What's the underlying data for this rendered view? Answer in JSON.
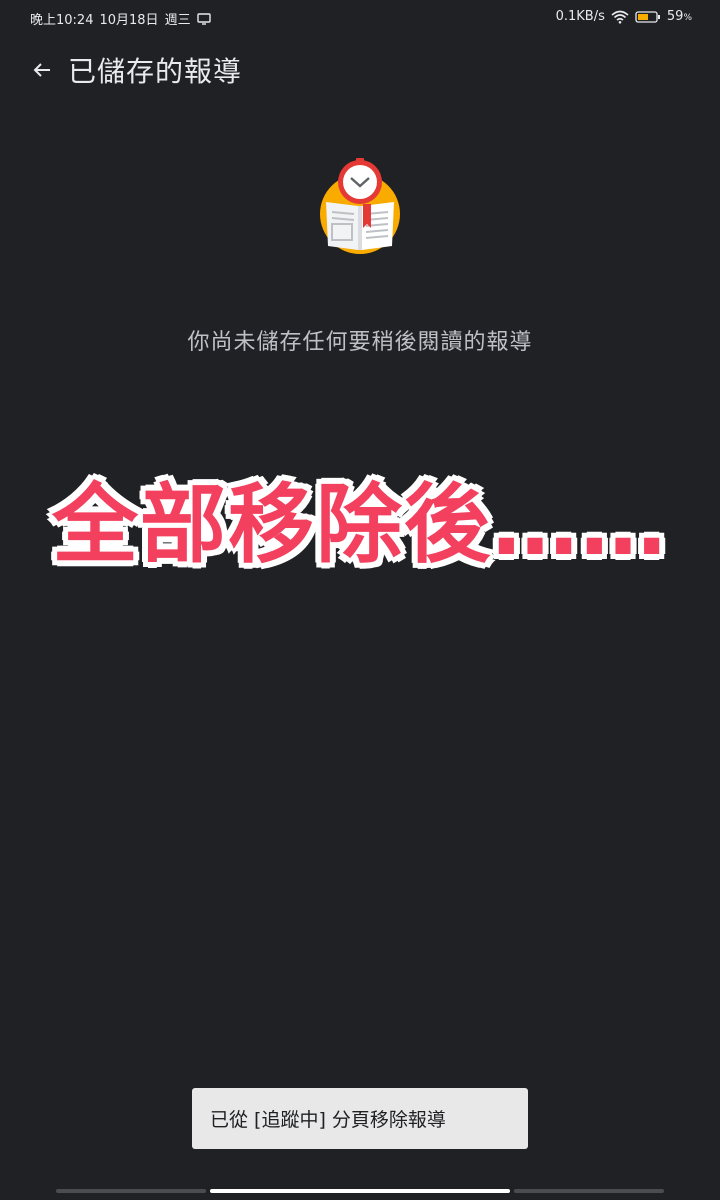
{
  "status_bar": {
    "time": "晚上10:24",
    "date": "10月18日",
    "weekday": "週三",
    "network_speed": "0.1KB/s",
    "battery_value": "59",
    "battery_unit": "%",
    "battery_level": 0.59
  },
  "app_bar": {
    "title": "已儲存的報導",
    "back_icon": "arrow-left-icon"
  },
  "empty_state": {
    "illustration_icon": "saved-news-clock-icon",
    "message": "你尚未儲存任何要稍後閱讀的報導"
  },
  "overlay": {
    "caption": "全部移除後……"
  },
  "snackbar": {
    "text": "已從 [追蹤中] 分頁移除報導"
  },
  "colors": {
    "background": "#202124",
    "overlay_text": "#f2405e",
    "snackbar_bg": "#e8e8e8",
    "illustration_circle": "#f9ab00",
    "clock_red": "#e53935"
  }
}
